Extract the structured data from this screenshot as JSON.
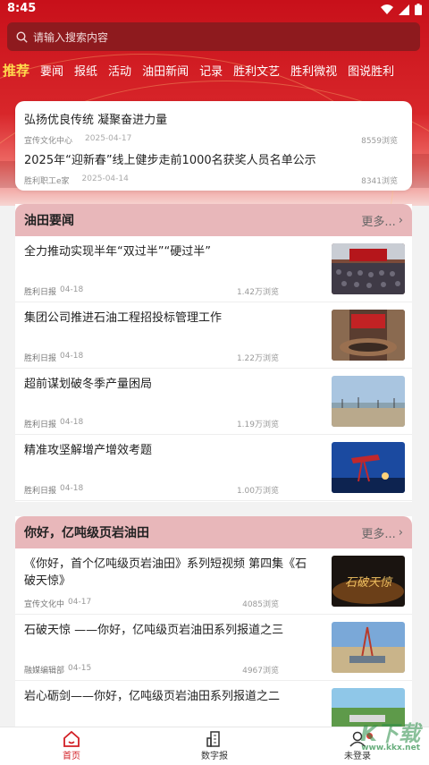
{
  "status": {
    "time": "8:45"
  },
  "search": {
    "placeholder": "请输入搜索内容"
  },
  "tabs": [
    "推荐",
    "要闻",
    "报纸",
    "活动",
    "油田新闻",
    "记录",
    "胜利文艺",
    "胜利微视",
    "图说胜利"
  ],
  "top_news": [
    {
      "title": "弘扬优良传统 凝聚奋进力量",
      "source": "宣传文化中心",
      "date": "2025-04-17",
      "views": "8559浏览"
    },
    {
      "title": "2025年“迎新春”线上健步走前1000名获奖人员名单公示",
      "source": "胜利职工e家",
      "date": "2025-04-14",
      "views": "8341浏览"
    }
  ],
  "section1": {
    "title": "油田要闻",
    "more": "更多...",
    "items": [
      {
        "title": "全力推动实现半年“双过半”“硬过半”",
        "source": "胜利日报",
        "date": "04-18",
        "views": "1.42万浏览",
        "thumb": "meeting-hall-photo"
      },
      {
        "title": "集团公司推进石油工程招投标管理工作",
        "source": "胜利日报",
        "date": "04-18",
        "views": "1.22万浏览",
        "thumb": "conference-room-photo"
      },
      {
        "title": "超前谋划破冬季产量困局",
        "source": "胜利日报",
        "date": "04-18",
        "views": "1.19万浏览",
        "thumb": "oilfield-landscape-photo"
      },
      {
        "title": "精准攻坚解增产增效考题",
        "source": "胜利日报",
        "date": "04-18",
        "views": "1.00万浏览",
        "thumb": "pumpjack-night-photo"
      }
    ]
  },
  "section2": {
    "title": "你好，亿吨级页岩油田",
    "more": "更多...",
    "items": [
      {
        "title": "《你好，首个亿吨级页岩油田》系列短视频 第四集《石破天惊》",
        "source": "宣传文化中",
        "date": "04-17",
        "views": "4085浏览",
        "thumb": "video-cover-poster",
        "thumb_text": "石破天惊"
      },
      {
        "title": "石破天惊 ——你好，亿吨级页岩油田系列报道之三",
        "source": "融媒编辑部",
        "date": "04-15",
        "views": "4967浏览",
        "thumb": "drilling-site-aerial-photo"
      },
      {
        "title": "岩心砺剑——你好，亿吨级页岩油田系列报道之二",
        "source": "",
        "date": "",
        "views": "",
        "thumb": "field-aerial-photo"
      }
    ]
  },
  "bottom_nav": [
    {
      "label": "首页",
      "icon": "home-icon"
    },
    {
      "label": "数字报",
      "icon": "building-icon"
    },
    {
      "label": "未登录",
      "icon": "user-icon"
    }
  ],
  "watermark": {
    "text": "K下载",
    "sub": "www.kkx.net"
  },
  "colors": {
    "brand_red": "#d21f25",
    "tab_active": "#ffd84d",
    "section_head": "#e8b7ba"
  }
}
